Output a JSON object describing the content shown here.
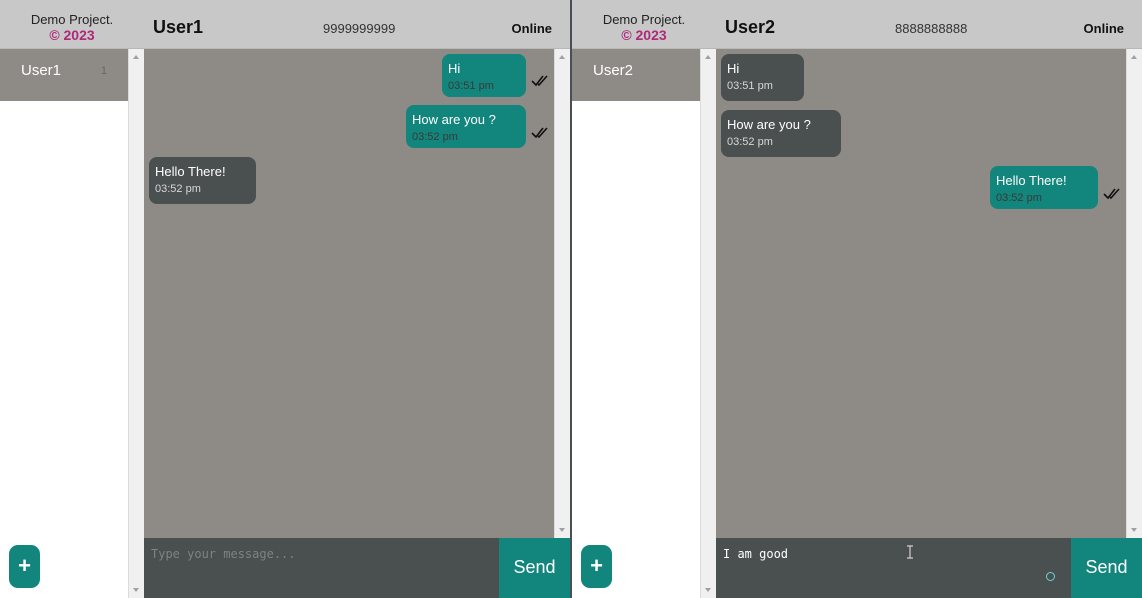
{
  "colors": {
    "accent": "#12857c",
    "brand": "#b0287a",
    "chat_bg": "#8e8a85",
    "header_bg": "#c8c8c8",
    "received_bubble": "#4a4f50"
  },
  "left": {
    "brand": {
      "name": "Demo Project.",
      "copyright": "© 2023"
    },
    "contacts": [
      {
        "name": "User1",
        "badge": "1"
      }
    ],
    "chat": {
      "title": "User1",
      "phone": "9999999999",
      "status": "Online"
    },
    "messages": [
      {
        "text": "Hi",
        "time": "03:51 pm",
        "direction": "sent",
        "read": true
      },
      {
        "text": "How are you ?",
        "time": "03:52 pm",
        "direction": "sent",
        "read": true
      },
      {
        "text": "Hello There!",
        "time": "03:52 pm",
        "direction": "received"
      }
    ],
    "composer": {
      "placeholder": "Type your message...",
      "value": ""
    },
    "send_label": "Send",
    "add_label": "+"
  },
  "right": {
    "brand": {
      "name": "Demo Project.",
      "copyright": "© 2023"
    },
    "contacts": [
      {
        "name": "User2"
      }
    ],
    "chat": {
      "title": "User2",
      "phone": "8888888888",
      "status": "Online"
    },
    "messages": [
      {
        "text": "Hi",
        "time": "03:51 pm",
        "direction": "received"
      },
      {
        "text": "How are you ?",
        "time": "03:52 pm",
        "direction": "received"
      },
      {
        "text": "Hello There!",
        "time": "03:52 pm",
        "direction": "sent",
        "read": true
      }
    ],
    "composer": {
      "placeholder": "",
      "value": "I am good"
    },
    "send_label": "Send",
    "add_label": "+"
  }
}
